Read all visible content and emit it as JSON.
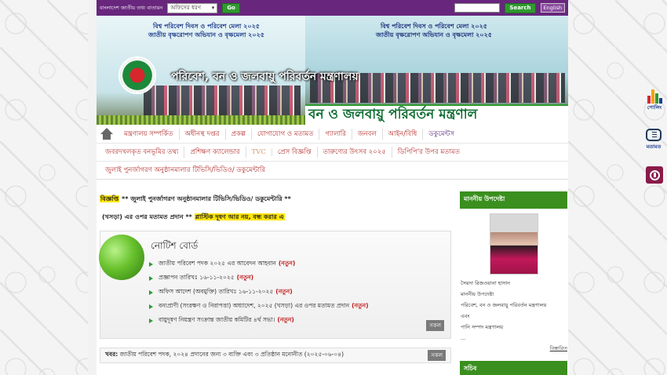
{
  "topbar": {
    "portal_link": "বাংলাদেশ জাতীয় তথ্য বাতায়ন",
    "office_select": "অফিসের ধরণ",
    "go_button": "Go",
    "search_placeholder": "",
    "search_button": "Search",
    "english_button": "English"
  },
  "banner": {
    "event_title_left": "বিশ্ব পরিবেশ দিবস ও পরিবেশ মেলা ২০২৫",
    "event_subtitle_left": "জাতীয় বৃক্ষরোপণ অভিযান ও বৃক্ষমেলা ২০২৫",
    "event_title_right": "বিশ্ব পরিবেশ দিবস ও পরিবেশ মেলা ২০২৫",
    "event_subtitle_right": "জাতীয় বৃক্ষরোপণ অভিযান ও বৃক্ষমেলা ২০২৫",
    "ministry_name": "পরিবেশ, বন ও জলবায়ু পরিবর্তন মন্ত্রণালয়",
    "ministry_strip": "বন ও জলবায়ু পরিবর্তন মন্ত্রণাল"
  },
  "nav": {
    "row1": [
      "মন্ত্রণালয় সম্পর্কিত",
      "অধীনস্থ দপ্তর",
      "প্রকল্প",
      "যোগাযোগ ও মতামত",
      "গ্যালারি",
      "জনবল",
      "আইন/বিধি",
      "ডকুমেন্টস"
    ],
    "row2": [
      "জবরদখলকৃত বনভূমির তথ্য",
      "প্রশিক্ষণ ক্যালেন্ডার",
      "TVC",
      "প্রেস বিজ্ঞপ্তি",
      "তারুণ্যের উৎসব ২০২৫",
      "ডিপিপি'র উপর মতামত"
    ],
    "row3": [
      "জুলাই পুনর্জাগরণ অনুষ্ঠানমালার টিভিসি/ভিডিও/ ডকুমেন্টারি"
    ]
  },
  "ticker": {
    "label": "বিজ্ঞপ্তি",
    "text1": " ** জুলাই পুনর্জাগরণ অনুষ্ঠানমালার টিভিসি/ভিডিও/ ডকুমেন্টারি **",
    "text2": "(খসড়া) এর ওপর মতামত প্রদান ** ",
    "text2_highlight": "প্লাস্টিক দূষণ আর নয়, বন্ধ করার এ"
  },
  "notice_board": {
    "title": "নোটিশ বোর্ড",
    "new_label": "(নতুন)",
    "items": [
      "জাতীয় পরিবেশ পদক ২০২৫ এর আবেদন আহবান",
      "প্রজ্ঞাপন তারিখঃ ১৬-১১-২০২৫",
      "অফিস আদেশ (অবমুক্তি) তারিখঃ ১৬-১১-২০২৫",
      "বন্যপ্রাণী (সংরক্ষণ ও নিরাপত্তা) অধ্যাদেশ, ২০২৫ (খসড়া) এর ওপর মতামত প্রদান",
      "বায়ুদূষণ নিয়ন্ত্রণ সংক্রান্ত জাতীয় কমিটির ৪র্থ সভা।"
    ],
    "all_button": "সকল"
  },
  "news": {
    "label": "খবর:",
    "text": "জাতীয় পরিবেশ পদক, ২০২৪ প্রদানের জন্য ৩ ব্যক্তি এবং ৩ প্রতিষ্ঠান মনোনীত (২০২৫-০৬-০৪)",
    "all_button": "সকল"
  },
  "sidebar": {
    "adviser_heading": "মাননীয় উপদেষ্টা",
    "adviser_lines": [
      "সৈয়দা রিজওয়ানা হাসান",
      "মাননীয় উপদেষ্টা",
      "পরিবেশ, বন ও জলবায়ু পরিবর্তন মন্ত্রণালয়",
      "এবং",
      "পানি সম্পদ মন্ত্রণালয়",
      "..."
    ],
    "details_link": "বিস্তারিত",
    "secretary_heading": "সচিব"
  },
  "widgets": {
    "poll_label": "পোলিং",
    "opinion_label": "মতামত"
  },
  "colors": {
    "topbar": "#68277d",
    "accent_green": "#3a8f1e",
    "nav_text": "#b22a2a",
    "new_tag": "#c01818",
    "highlight": "#ffe600"
  }
}
